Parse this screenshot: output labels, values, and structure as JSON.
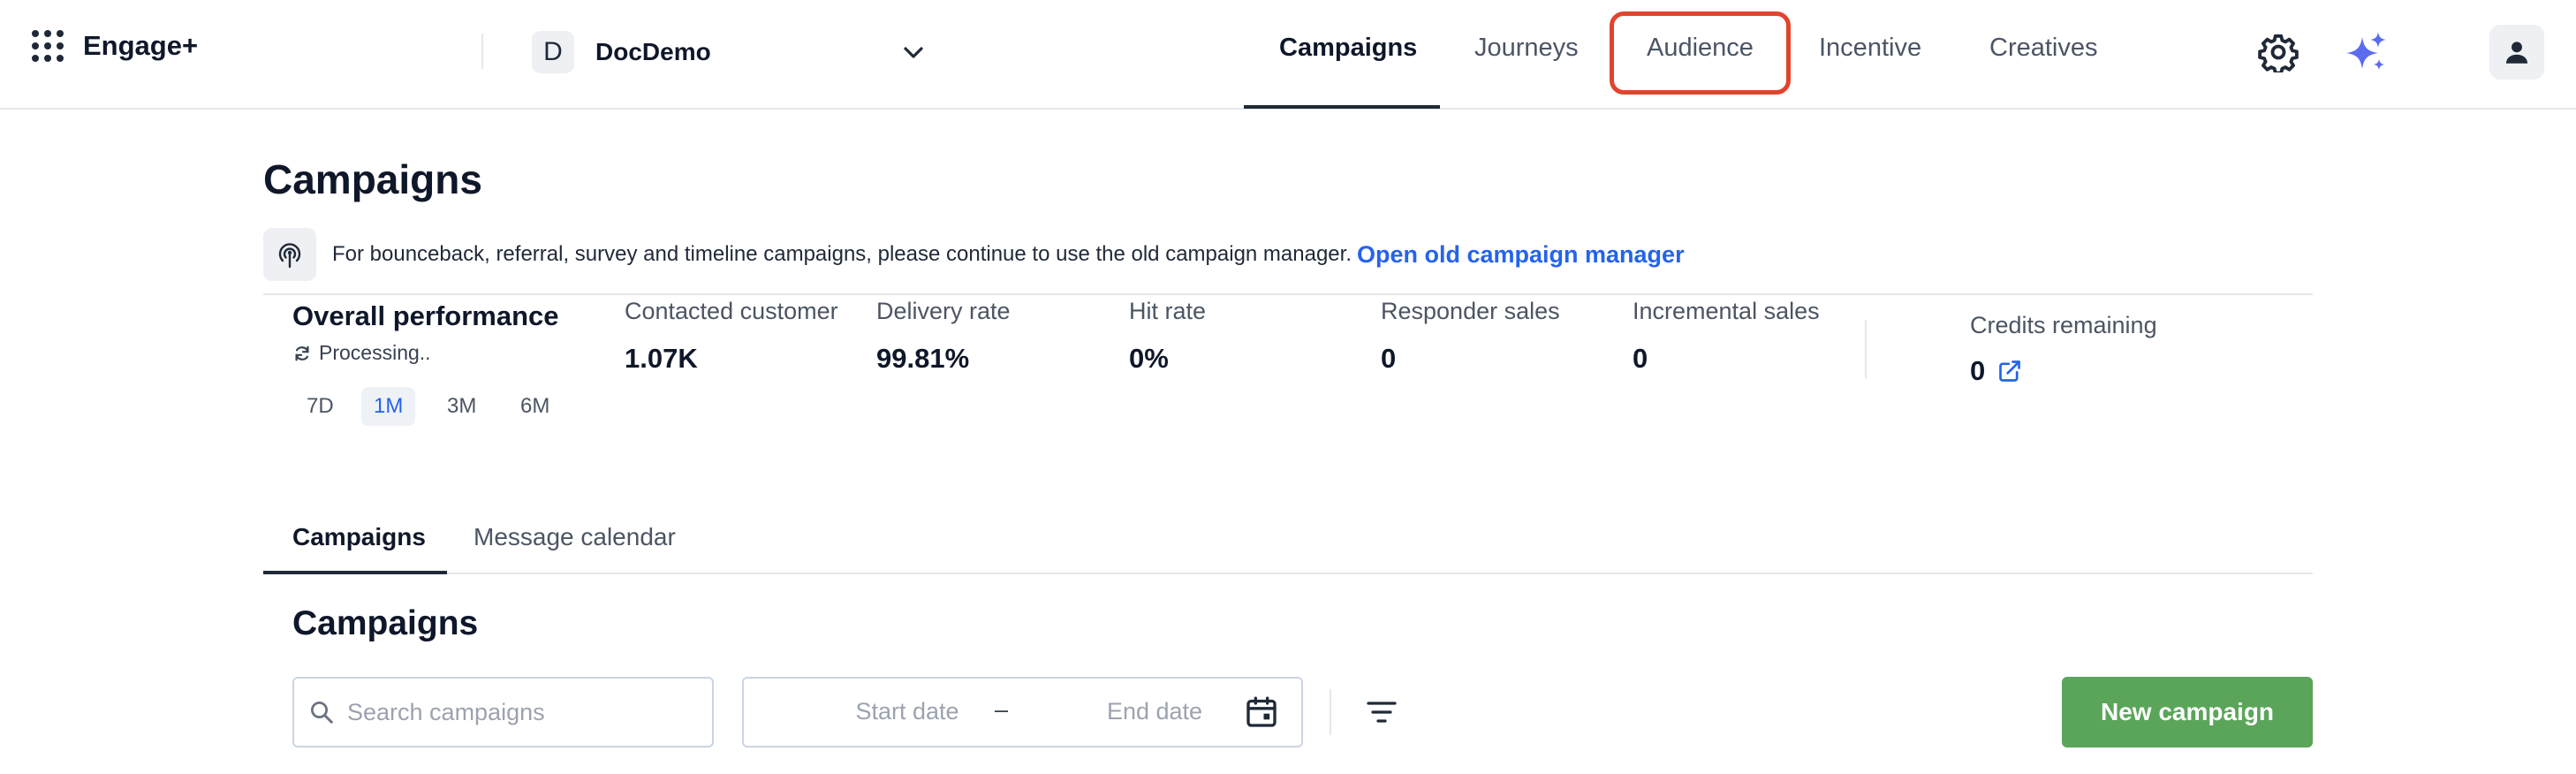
{
  "app": {
    "brand": "Engage+"
  },
  "org": {
    "initial": "D",
    "name": "DocDemo"
  },
  "nav": {
    "tabs": [
      {
        "label": "Campaigns",
        "active": true
      },
      {
        "label": "Journeys",
        "active": false
      },
      {
        "label": "Audience",
        "active": false,
        "highlighted": true
      },
      {
        "label": "Incentive",
        "active": false
      },
      {
        "label": "Creatives",
        "active": false
      }
    ]
  },
  "icons": {
    "apps": "grid-dots-icon",
    "chevron": "chevron-down-icon",
    "settings": "gear-icon",
    "ai": "sparkle-icon",
    "user": "user-icon",
    "notice": "broadcast-icon",
    "processing": "refresh-icon",
    "external": "external-link-icon",
    "search": "search-icon",
    "calendar": "calendar-icon",
    "filter": "filter-icon"
  },
  "colors": {
    "accent_link": "#2563eb",
    "primary_button": "#5aa55a",
    "highlight": "#e1442d"
  },
  "page": {
    "title": "Campaigns"
  },
  "notice": {
    "text": "For bounceback, referral, survey and timeline campaigns, please continue to use the old campaign manager.",
    "link": "Open old campaign manager"
  },
  "performance": {
    "title": "Overall performance",
    "status": "Processing..",
    "ranges": [
      {
        "label": "7D",
        "active": false
      },
      {
        "label": "1M",
        "active": true
      },
      {
        "label": "3M",
        "active": false
      },
      {
        "label": "6M",
        "active": false
      }
    ],
    "metrics": [
      {
        "label": "Contacted customer",
        "value": "1.07K"
      },
      {
        "label": "Delivery rate",
        "value": "99.81%"
      },
      {
        "label": "Hit rate",
        "value": "0%"
      },
      {
        "label": "Responder sales",
        "value": "0"
      },
      {
        "label": "Incremental sales",
        "value": "0"
      }
    ],
    "credits": {
      "label": "Credits remaining",
      "value": "0"
    }
  },
  "subtabs": [
    {
      "label": "Campaigns",
      "active": true
    },
    {
      "label": "Message calendar",
      "active": false
    }
  ],
  "section": {
    "title": "Campaigns"
  },
  "search": {
    "placeholder": "Search campaigns",
    "value": ""
  },
  "date_range": {
    "start_placeholder": "Start date",
    "separator": "–",
    "end_placeholder": "End date"
  },
  "new_campaign": {
    "label": "New campaign"
  }
}
